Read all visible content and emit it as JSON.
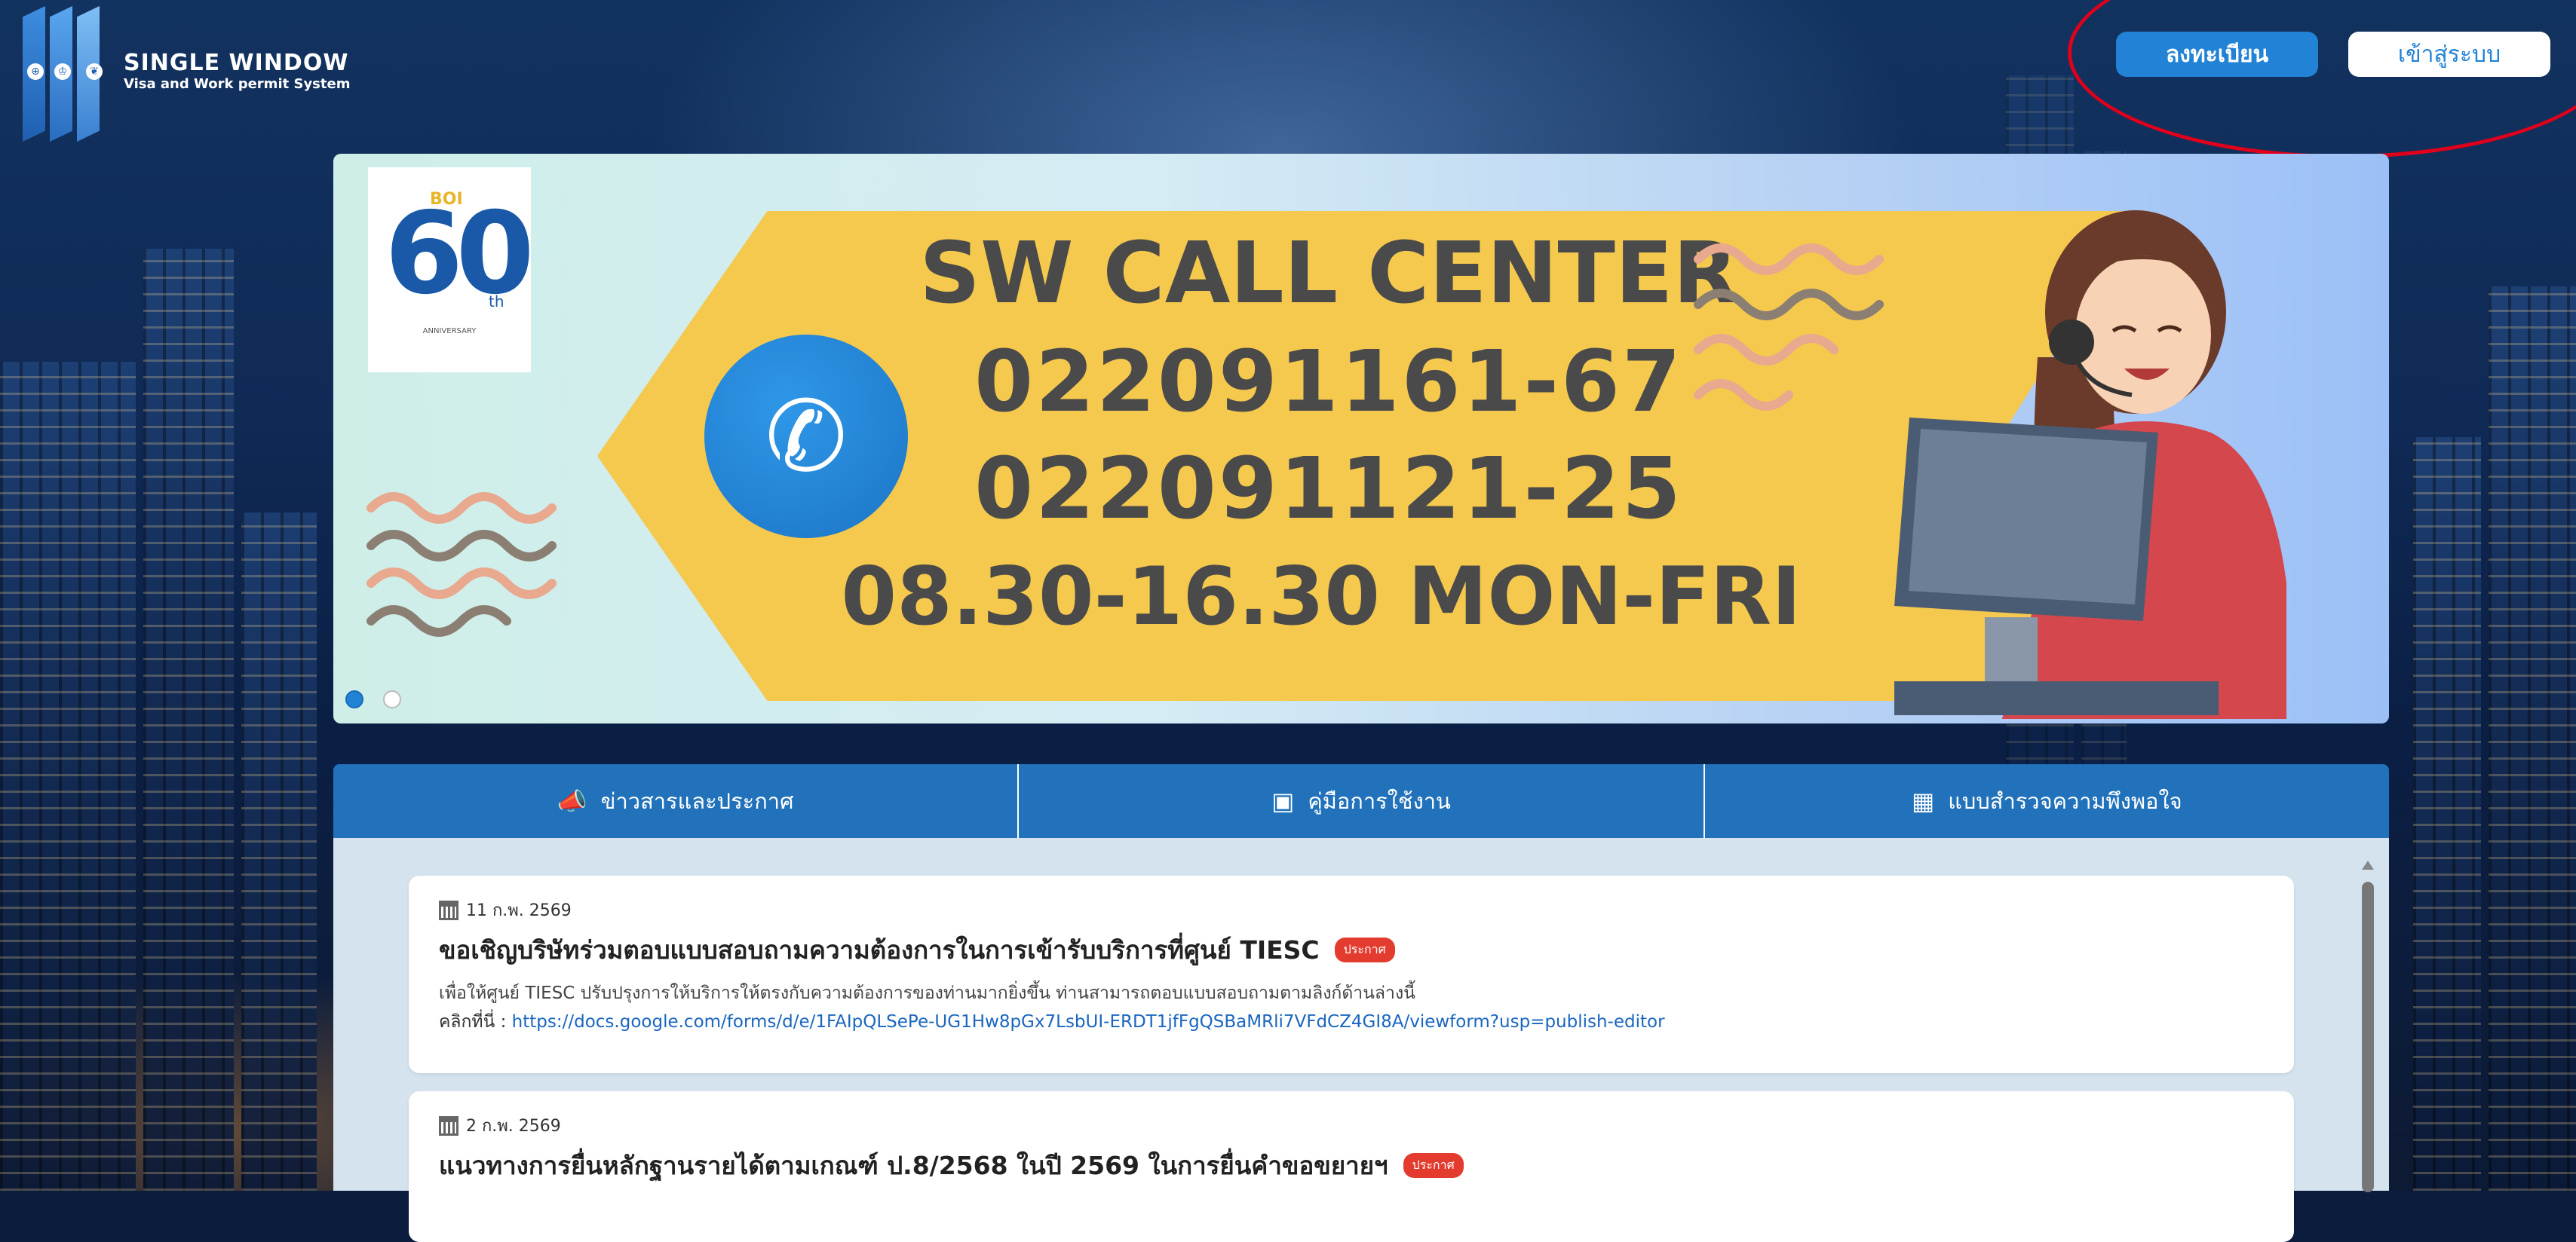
{
  "brand": {
    "title": "SINGLE WINDOW",
    "subtitle": "Visa and Work permit System"
  },
  "header": {
    "register_label": "ลงทะเบียน",
    "login_label": "เข้าสู่ระบบ",
    "annotation_color": "#e0001b"
  },
  "banner": {
    "logo_tag": "BOI",
    "logo_number": "60",
    "logo_suffix": "th",
    "logo_caption": "ANNIVERSARY",
    "headline": "SW CALL CENTER",
    "phone_1": "022091161-67",
    "phone_2": "022091121-25",
    "hours": "08.30-16.30 MON-FRI",
    "slide_index": 1,
    "slide_count": 2
  },
  "tabs": [
    {
      "label": "ข่าวสารและประกาศ",
      "icon": "megaphone-icon"
    },
    {
      "label": "คู่มือการใช้งาน",
      "icon": "manual-icon"
    },
    {
      "label": "แบบสำรวจความพึงพอใจ",
      "icon": "survey-icon"
    }
  ],
  "news": [
    {
      "date": "11 ก.พ. 2569",
      "title": "ขอเชิญบริษัทร่วมตอบแบบสอบถามความต้องการในการเข้ารับบริการที่ศูนย์ TIESC",
      "badge": "ประกาศ",
      "description": "เพื่อให้ศูนย์ TIESC ปรับปรุงการให้บริการให้ตรงกับความต้องการของท่านมากยิ่งขึ้น ท่านสามารถตอบแบบสอบถามตามลิงก์ด้านล่างนี้",
      "link_prefix": "คลิกที่นี่ : ",
      "link": "https://docs.google.com/forms/d/e/1FAIpQLSePe-UG1Hw8pGx7LsbUI-ERDT1jfFgQSBaMRli7VFdCZ4GI8A/viewform?usp=publish-editor"
    },
    {
      "date": "2 ก.พ. 2569",
      "title": "แนวทางการยื่นหลักฐานรายได้ตามเกณฑ์ ป.8/2568 ในปี 2569 ในการยื่นคำขอขยายฯ",
      "badge": "ประกาศ"
    }
  ],
  "colors": {
    "primary": "#2182d6",
    "tab_bar": "#2172bb",
    "badge": "#e33c2f",
    "banner_ribbon": "#f5c84e"
  }
}
